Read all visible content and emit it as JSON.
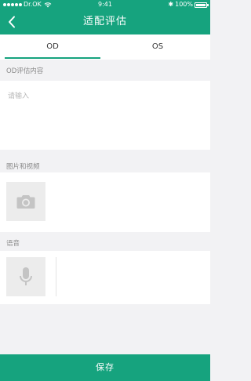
{
  "status_bar": {
    "carrier": "Dr.OK",
    "time": "9:41",
    "battery": "100%"
  },
  "nav": {
    "title": "适配评估",
    "back_icon": "chevron-left-icon"
  },
  "tabs": [
    {
      "label": "OD",
      "active": true
    },
    {
      "label": "OS",
      "active": false
    }
  ],
  "form": {
    "od_content_label": "OD评估内容",
    "od_content_placeholder": "请输入",
    "od_content_value": "",
    "media_label": "图片和视频",
    "media_icon": "camera-icon",
    "voice_label": "语音",
    "voice_icon": "microphone-icon"
  },
  "footer": {
    "save_label": "保存"
  },
  "colors": {
    "accent": "#16a37e",
    "background": "#f2f2f4"
  }
}
